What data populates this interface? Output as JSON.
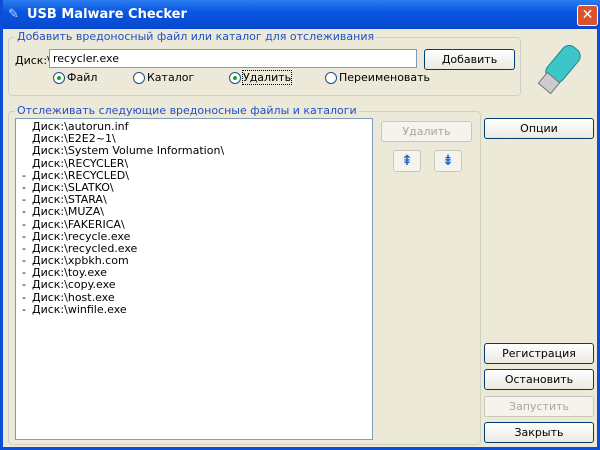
{
  "window": {
    "title": "USB Malware Checker"
  },
  "add_group": {
    "label": "Добавить вредоносный файл или каталог для отслеживания",
    "disk_label": "Диск:\\",
    "input_value": "recycler.exe",
    "add_button": "Добавить",
    "radios": [
      {
        "label": "Файл",
        "checked": true
      },
      {
        "label": "Каталог",
        "checked": false
      },
      {
        "label": "Удалить",
        "checked": true
      },
      {
        "label": "Переименовать",
        "checked": false
      }
    ]
  },
  "list_group": {
    "label": "Отслеживать следующие вредоносные файлы и каталоги",
    "delete_button": "Удалить",
    "items": [
      {
        "mark": "",
        "path": "Диск:\\autorun.inf"
      },
      {
        "mark": "",
        "path": "Диск:\\E2E2~1\\"
      },
      {
        "mark": "",
        "path": "Диск:\\System Volume Information\\"
      },
      {
        "mark": "",
        "path": "Диск:\\RECYCLER\\"
      },
      {
        "mark": "-",
        "path": "Диск:\\RECYCLED\\"
      },
      {
        "mark": "-",
        "path": "Диск:\\SLATKO\\"
      },
      {
        "mark": "-",
        "path": "Диск:\\STARA\\"
      },
      {
        "mark": "-",
        "path": "Диск:\\MUZA\\"
      },
      {
        "mark": "-",
        "path": "Диск:\\FAKERICA\\"
      },
      {
        "mark": "-",
        "path": "Диск:\\recycle.exe"
      },
      {
        "mark": "-",
        "path": "Диск:\\recycled.exe"
      },
      {
        "mark": "-",
        "path": "Диск:\\xpbkh.com"
      },
      {
        "mark": "-",
        "path": "Диск:\\toy.exe"
      },
      {
        "mark": "-",
        "path": "Диск:\\copy.exe"
      },
      {
        "mark": "-",
        "path": "Диск:\\host.exe"
      },
      {
        "mark": "-",
        "path": "Диск:\\winfile.exe"
      }
    ]
  },
  "side": {
    "options": "Опции",
    "register": "Регистрация",
    "stop": "Остановить",
    "start": "Запустить",
    "close": "Закрыть"
  }
}
